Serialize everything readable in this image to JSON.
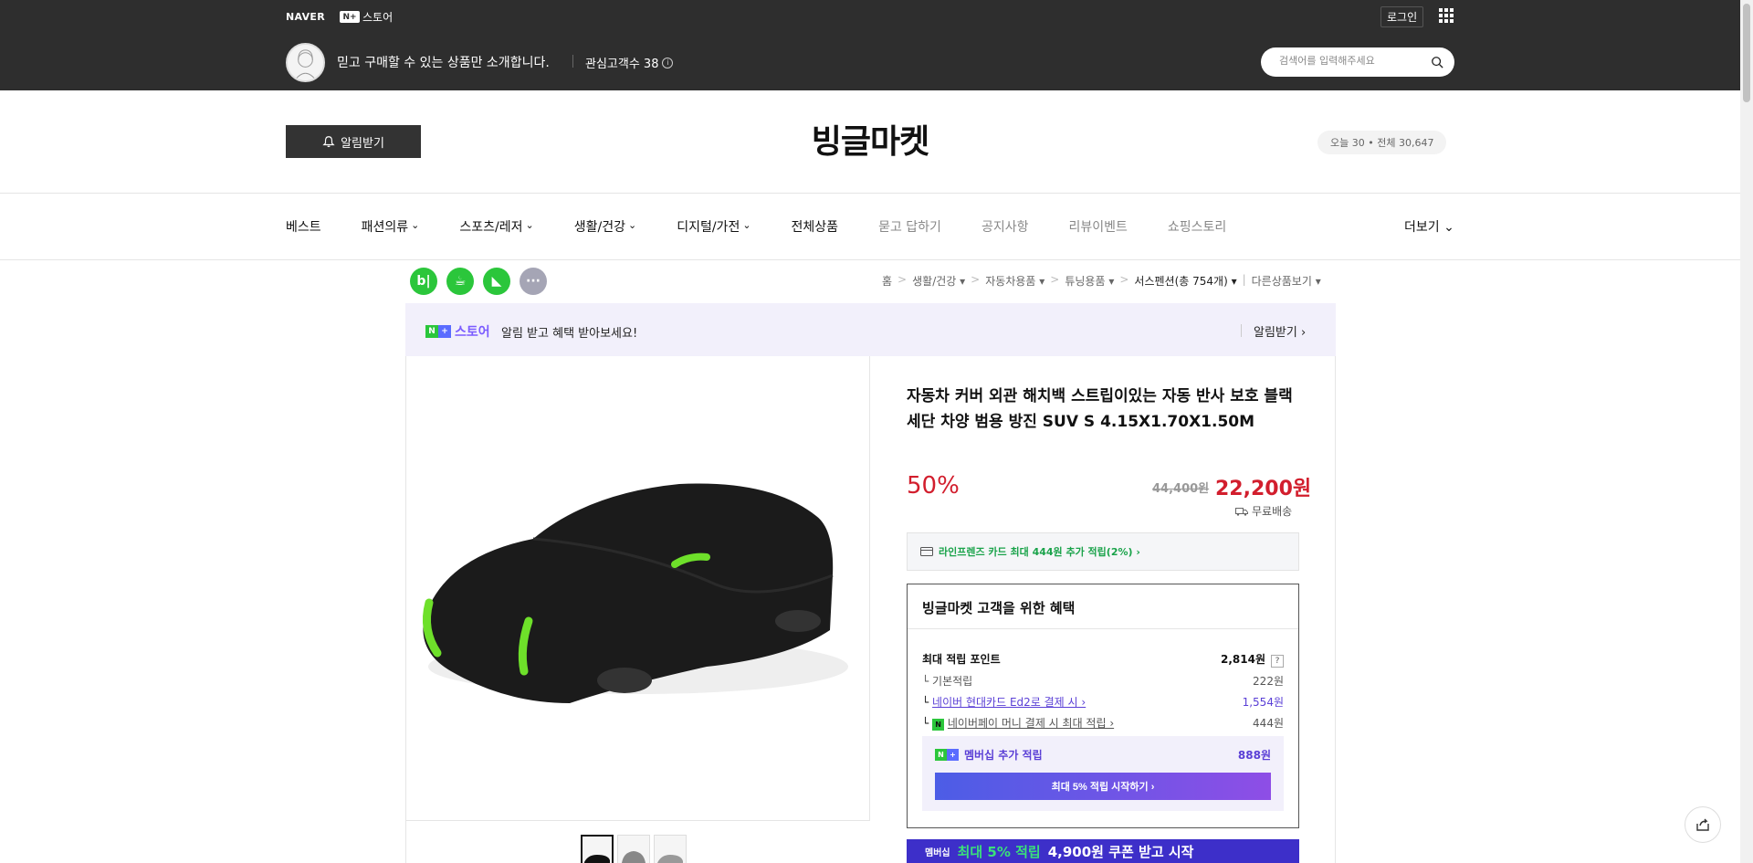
{
  "gnb": {
    "naver": "NAVER",
    "nstore_badge": "N+",
    "nstore": "스토어",
    "login": "로그인"
  },
  "profile": {
    "intro": "믿고 구매할 수 있는 상품만 소개합니다.",
    "fans": "관심고객수 38"
  },
  "search": {
    "placeholder": "검색어를 입력해주세요"
  },
  "store": {
    "alarm": "알림받기",
    "name": "빙글마켓",
    "visitors": "오늘 30 • 전체 30,647"
  },
  "nav": {
    "items": [
      "베스트",
      "패션의류",
      "스포츠/레저",
      "생활/건강",
      "디지털/가전",
      "전체상품",
      "묻고 답하기",
      "공지사항",
      "리뷰이벤트",
      "쇼핑스토리"
    ],
    "more": "더보기"
  },
  "breadcrumb": [
    "홈",
    "생활/건강",
    "자동차용품",
    "튜닝용품",
    "서스펜션(총 754개)",
    "다른상품보기"
  ],
  "banner": {
    "logo": "스토어",
    "text": "알림 받고 혜택 받아보세요!",
    "link": "알림받기 ›"
  },
  "product": {
    "title": "자동차 커버 외관 해치백 스트립이있는 자동 반사 보호 블랙 세단 차양 범용 방진 SUV S 4.15X1.70X1.50M",
    "discount": "50%",
    "original_price": "44,400원",
    "sale_price": "22,200원",
    "shipping": "무료배송",
    "card_benefit": "라인프렌즈 카드 최대 444원 추가 적립(2%) ›"
  },
  "benefit": {
    "head": "빙글마켓 고객을 위한 혜택",
    "rows": [
      {
        "label": "최대 적립 포인트",
        "value": "2,814원"
      },
      {
        "label": "기본적립",
        "value": "222원"
      },
      {
        "label": "네이버 현대카드 Ed2로 결제 시 ›",
        "value": "1,554원"
      },
      {
        "label": "네이버페이 머니 결제 시 최대 적립 ›",
        "value": "444원"
      }
    ],
    "membership_label": "멤버십 추가 적립",
    "membership_value": "888원",
    "membership_button": "최대 5% 적립 시작하기 ›"
  },
  "promo": {
    "badge": "멤버십",
    "text": "최대 5% 적립",
    "coupon": "4,900원 쿠폰 받고 시작"
  },
  "colors": {
    "header": "#2e2e2e",
    "accent_red": "#d21e2d",
    "naver_green": "#2bc63b",
    "purple": "#5a3fd6"
  }
}
